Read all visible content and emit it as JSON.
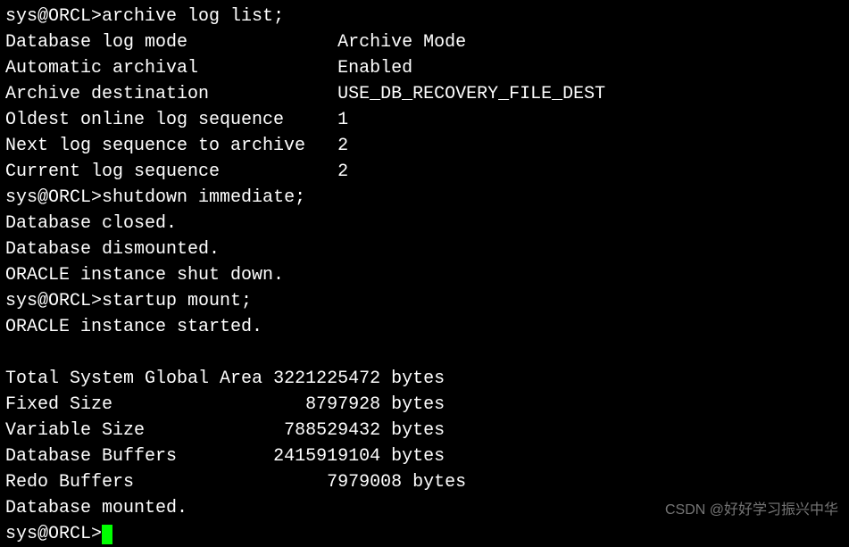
{
  "prompt": "sys@ORCL>",
  "commands": {
    "archive_log_list": "archive log list;",
    "shutdown": "shutdown immediate;",
    "startup": "startup mount;"
  },
  "archive_log": {
    "labels": {
      "db_log_mode": "Database log mode",
      "auto_archival": "Automatic archival",
      "archive_dest": "Archive destination",
      "oldest_online": "Oldest online log sequence",
      "next_seq": "Next log sequence to archive",
      "current_seq": "Current log sequence"
    },
    "values": {
      "db_log_mode": "Archive Mode",
      "auto_archival": "Enabled",
      "archive_dest": "USE_DB_RECOVERY_FILE_DEST",
      "oldest_online": "1",
      "next_seq": "2",
      "current_seq": "2"
    }
  },
  "shutdown_msgs": {
    "closed": "Database closed.",
    "dismounted": "Database dismounted.",
    "shutdown": "ORACLE instance shut down."
  },
  "startup_msgs": {
    "started": "ORACLE instance started."
  },
  "sga": {
    "labels": {
      "total": "Total System Global Area",
      "fixed": "Fixed Size",
      "variable": "Variable Size",
      "buffers": "Database Buffers",
      "redo": "Redo Buffers"
    },
    "values": {
      "total": "3221225472",
      "fixed": "8797928",
      "variable": "788529432",
      "buffers": "2415919104",
      "redo": "7979008"
    },
    "unit": "bytes"
  },
  "mount_msg": "Database mounted.",
  "watermark": "CSDN @好好学习振兴中华"
}
